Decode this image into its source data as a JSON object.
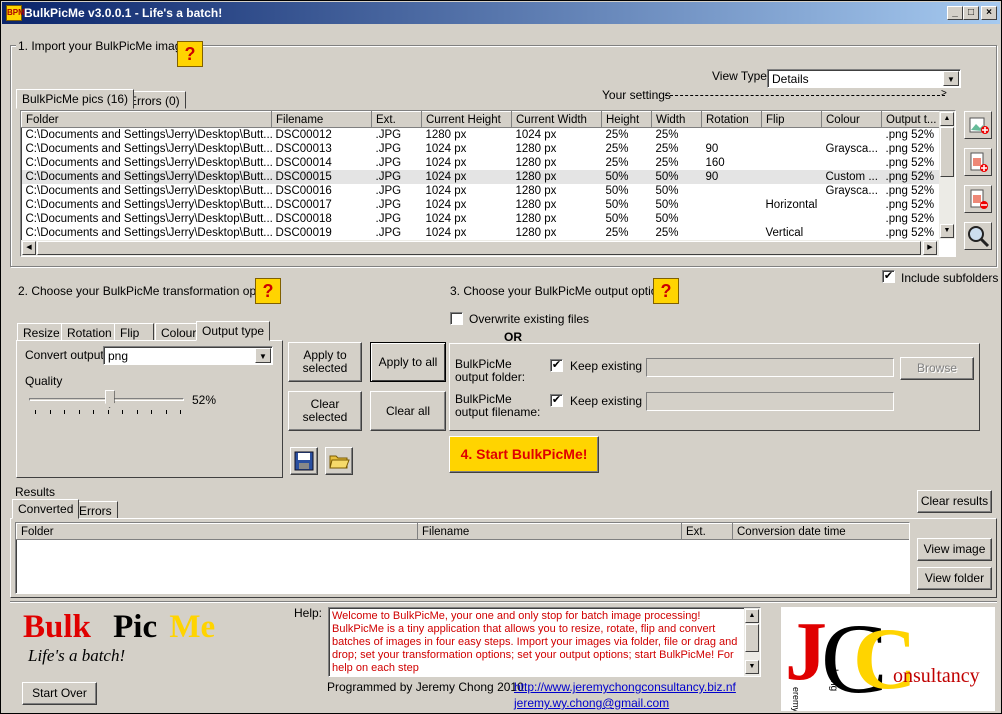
{
  "window": {
    "title": "BulkPicMe v3.0.0.1 - Life's a batch!",
    "icon": "app-icon",
    "icon_text": "BPM"
  },
  "import": {
    "legend": "1. Import your BulkPicMe images",
    "help": "?",
    "view_type_label": "View Type",
    "view_type_value": "Details",
    "your_settings": "Your settings",
    "tabs": [
      {
        "label": "BulkPicMe pics (16)"
      },
      {
        "label": "Errors (0)"
      }
    ],
    "columns": [
      "Folder",
      "Filename",
      "Ext.",
      "Current Height",
      "Current Width",
      "Height",
      "Width",
      "Rotation",
      "Flip",
      "Colour",
      "Output t..."
    ],
    "rows": [
      [
        "C:\\Documents and Settings\\Jerry\\Desktop\\Butt...",
        "DSC00012",
        ".JPG",
        "1280 px",
        "1024 px",
        "25%",
        "25%",
        "",
        "",
        "",
        ".png 52%"
      ],
      [
        "C:\\Documents and Settings\\Jerry\\Desktop\\Butt...",
        "DSC00013",
        ".JPG",
        "1024 px",
        "1280 px",
        "25%",
        "25%",
        "90",
        "",
        "Graysca...",
        ".png 52%"
      ],
      [
        "C:\\Documents and Settings\\Jerry\\Desktop\\Butt...",
        "DSC00014",
        ".JPG",
        "1024 px",
        "1280 px",
        "25%",
        "25%",
        "160",
        "",
        "",
        ".png 52%"
      ],
      [
        "C:\\Documents and Settings\\Jerry\\Desktop\\Butt...",
        "DSC00015",
        ".JPG",
        "1024 px",
        "1280 px",
        "50%",
        "50%",
        "90",
        "",
        "Custom ...",
        ".png 52%"
      ],
      [
        "C:\\Documents and Settings\\Jerry\\Desktop\\Butt...",
        "DSC00016",
        ".JPG",
        "1024 px",
        "1280 px",
        "50%",
        "50%",
        "",
        "",
        "Graysca...",
        ".png 52%"
      ],
      [
        "C:\\Documents and Settings\\Jerry\\Desktop\\Butt...",
        "DSC00017",
        ".JPG",
        "1024 px",
        "1280 px",
        "50%",
        "50%",
        "",
        "Horizontal",
        "",
        ".png 52%"
      ],
      [
        "C:\\Documents and Settings\\Jerry\\Desktop\\Butt...",
        "DSC00018",
        ".JPG",
        "1024 px",
        "1280 px",
        "50%",
        "50%",
        "",
        "",
        "",
        ".png 52%"
      ],
      [
        "C:\\Documents and Settings\\Jerry\\Desktop\\Butt...",
        "DSC00019",
        ".JPG",
        "1024 px",
        "1280 px",
        "25%",
        "25%",
        "",
        "Vertical",
        "",
        ".png 52%"
      ]
    ],
    "selected_row": 3,
    "side_buttons": [
      "add-image-icon",
      "add-folder-icon",
      "remove-image-icon",
      "zoom-icon"
    ],
    "include_subfolders": "Include subfolders"
  },
  "transform": {
    "title": "2. Choose your BulkPicMe transformation options",
    "help": "?",
    "tabs": [
      {
        "label": "Resize"
      },
      {
        "label": "Rotation"
      },
      {
        "label": "Flip"
      },
      {
        "label": "Colour"
      },
      {
        "label": "Output type"
      }
    ],
    "convert_label": "Convert output",
    "convert_value": "png",
    "quality_label": "Quality",
    "quality_value": "52%",
    "quality_fraction": 0.52
  },
  "actions": {
    "apply_selected": "Apply to selected",
    "apply_all": "Apply to all",
    "clear_selected": "Clear selected",
    "clear_all": "Clear all",
    "save_icon": "save-icon",
    "open_icon": "open-folder-icon"
  },
  "output": {
    "title": "3. Choose your BulkPicMe output options",
    "help": "?",
    "overwrite": "Overwrite existing files",
    "or": "OR",
    "folder_label": "BulkPicMe output folder:",
    "filename_label": "BulkPicMe output filename:",
    "keep_existing": "Keep existing",
    "browse": "Browse",
    "start": "4. Start BulkPicMe!"
  },
  "results": {
    "title": "Results",
    "tabs": [
      {
        "label": "Converted"
      },
      {
        "label": "Errors"
      }
    ],
    "columns": [
      "Folder",
      "Filename",
      "Ext.",
      "Conversion date time"
    ],
    "clear_results": "Clear results",
    "view_image": "View image",
    "view_folder": "View folder"
  },
  "footer": {
    "logo_bulk": "Bulk",
    "logo_pic": "Pic",
    "logo_me": "Me",
    "tagline": "Life's a batch!",
    "start_over": "Start Over",
    "help_label": "Help:",
    "help_text": "Welcome to BulkPicMe, your one and only stop for batch image processing! BulkPicMe is a tiny application that allows you to resize, rotate, flip and convert batches of images in four easy steps. Import your images via folder, file or drag and drop; set your transformation options; set your output options; start BulkPicMe! For help on each step",
    "programmed_by": "Programmed by Jeremy Chong 2010.",
    "website": "http://www.jeremychongconsultancy.biz.nf",
    "email": "jeremy.wy.chong@gmail.com",
    "jc_j": "J",
    "jc_c": "C",
    "jc_sub1": "eremy",
    "jc_sub2": "hong",
    "jc_word": "onsultancy"
  },
  "colors": {
    "title_start": "#0a246a",
    "help_bg": "#ffd400",
    "start_bg": "#ffd400",
    "start_text": "#e00000",
    "logo_red": "#e00000",
    "logo_yellow": "#ffd400"
  }
}
